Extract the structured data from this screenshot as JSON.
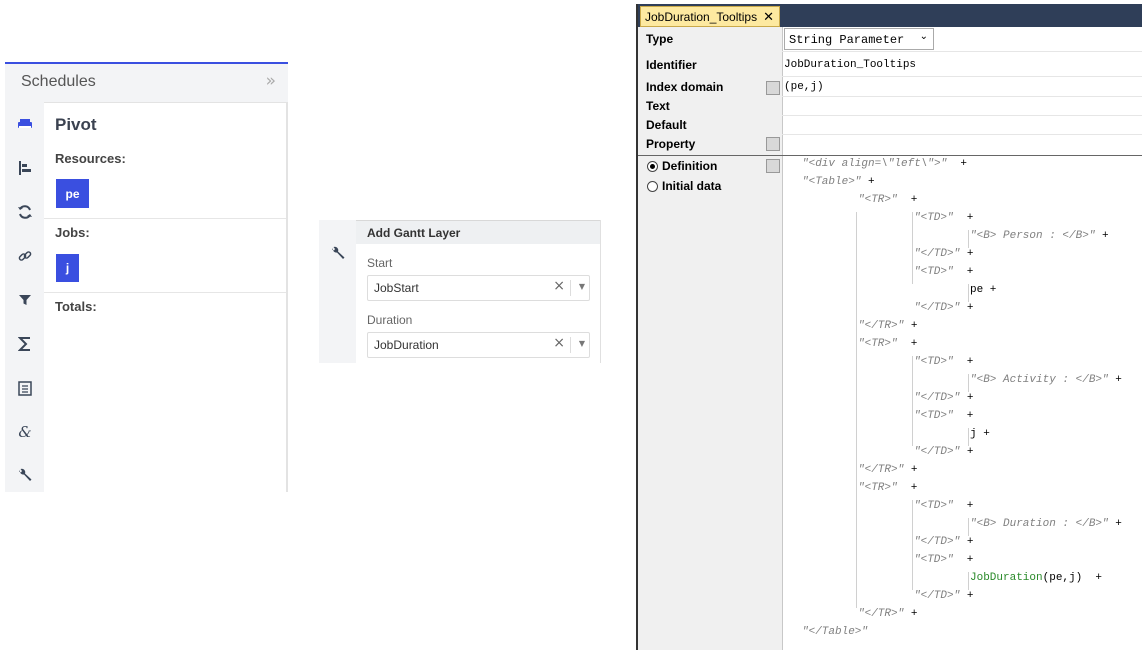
{
  "schedules": {
    "header_title": "Schedules",
    "collapse_glyph": "»",
    "rail_icons": [
      "layers-icon",
      "gantt-icon",
      "refresh-icon",
      "link-icon",
      "filter-icon",
      "sigma-icon",
      "list-icon",
      "ampersand-icon",
      "wrench-icon"
    ],
    "pivot_title": "Pivot",
    "resources_label": "Resources:",
    "resources_chip": "pe",
    "jobs_label": "Jobs:",
    "jobs_chip": "j",
    "totals_label": "Totals:"
  },
  "gantt_layer": {
    "header": "Add Gantt Layer",
    "start_label": "Start",
    "start_value": "JobStart",
    "duration_label": "Duration",
    "duration_value": "JobDuration",
    "clear_glyph": "×",
    "arrow_glyph": "▼"
  },
  "attribute_window": {
    "tab_title": "JobDuration_Tooltips",
    "tab_close": "✕",
    "labels": {
      "type": "Type",
      "identifier": "Identifier",
      "index_domain": "Index domain",
      "text": "Text",
      "default": "Default",
      "property": "Property"
    },
    "type_value": "String Parameter",
    "type_dropdown": "⌄",
    "identifier_value": "JobDuration_Tooltips",
    "index_domain_value": "(pe,j)",
    "radio_definition": "Definition",
    "radio_initial_data": "Initial data",
    "definition_lines": [
      {
        "indent": 0,
        "str": "\"<div align=\\\"left\\\">\"",
        "tail": "  +"
      },
      {
        "indent": 0,
        "str": "\"<Table>\"",
        "tail": " +"
      },
      {
        "indent": 1,
        "str": "\"<TR>\"",
        "tail": "  +"
      },
      {
        "indent": 2,
        "str": "\"<TD>\"",
        "tail": "  +"
      },
      {
        "indent": 3,
        "str": "\"<B> Person : </B>\"",
        "tail": " +"
      },
      {
        "indent": 2,
        "str": "\"</TD>\"",
        "tail": " +"
      },
      {
        "indent": 2,
        "str": "\"<TD>\"",
        "tail": "  +"
      },
      {
        "indent": 3,
        "id": "pe",
        "tail": " +"
      },
      {
        "indent": 2,
        "str": "\"</TD>\"",
        "tail": " +"
      },
      {
        "indent": 1,
        "str": "\"</TR>\"",
        "tail": " +"
      },
      {
        "indent": 1,
        "str": "\"<TR>\"",
        "tail": "  +"
      },
      {
        "indent": 2,
        "str": "\"<TD>\"",
        "tail": "  +"
      },
      {
        "indent": 3,
        "str": "\"<B> Activity : </B>\"",
        "tail": " +"
      },
      {
        "indent": 2,
        "str": "\"</TD>\"",
        "tail": " +"
      },
      {
        "indent": 2,
        "str": "\"<TD>\"",
        "tail": "  +"
      },
      {
        "indent": 3,
        "id": "j",
        "tail": " +"
      },
      {
        "indent": 2,
        "str": "\"</TD>\"",
        "tail": " +"
      },
      {
        "indent": 1,
        "str": "\"</TR>\"",
        "tail": " +"
      },
      {
        "indent": 1,
        "str": "\"<TR>\"",
        "tail": "  +"
      },
      {
        "indent": 2,
        "str": "\"<TD>\"",
        "tail": "  +"
      },
      {
        "indent": 3,
        "str": "\"<B> Duration : </B>\"",
        "tail": " +"
      },
      {
        "indent": 2,
        "str": "\"</TD>\"",
        "tail": " +"
      },
      {
        "indent": 2,
        "str": "\"<TD>\"",
        "tail": "  +"
      },
      {
        "indent": 3,
        "fn": "JobDuration",
        "args": "(pe,j)",
        "tail": "  +"
      },
      {
        "indent": 2,
        "str": "\"</TD>\"",
        "tail": " +"
      },
      {
        "indent": 1,
        "str": "\"</TR>\"",
        "tail": " +"
      },
      {
        "indent": 0,
        "str": "\"</Table>\"",
        "tail": ""
      }
    ]
  }
}
